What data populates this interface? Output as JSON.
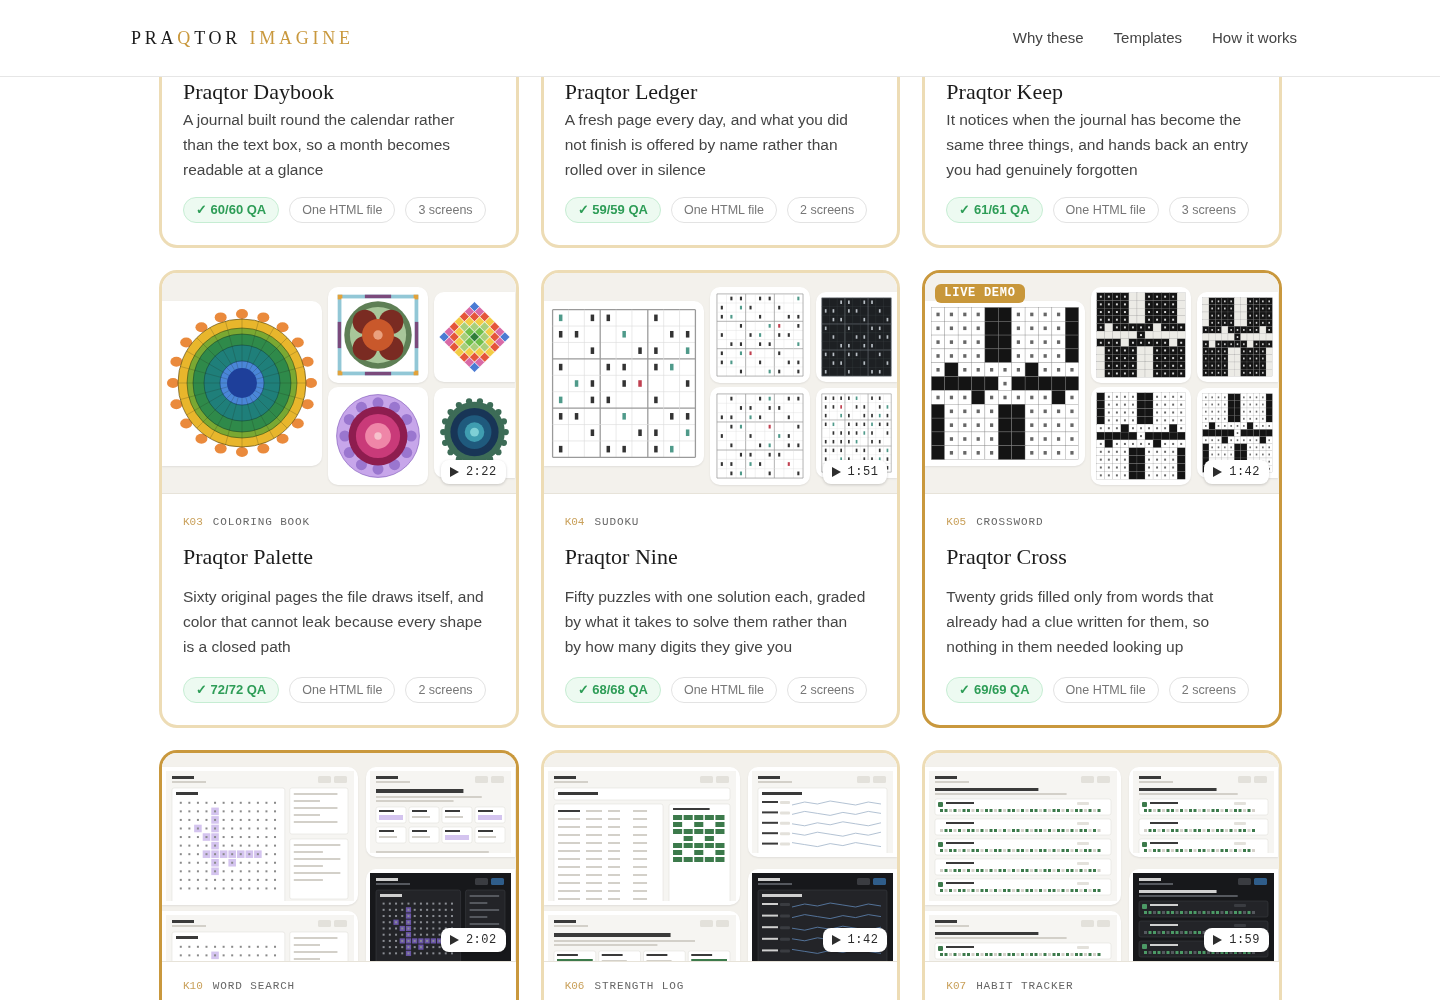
{
  "header": {
    "logo": [
      {
        "parts": [
          {
            "text": "PRA",
            "accent": false
          },
          {
            "text": "Q",
            "accent": true
          },
          {
            "text": "TOR",
            "accent": false
          }
        ]
      },
      {
        "parts": [
          {
            "text": "IMAGINE",
            "accent": true
          }
        ]
      }
    ],
    "nav": [
      "Why these",
      "Templates",
      "How it works"
    ]
  },
  "rows": [
    {
      "cards": [
        {
          "highlighted": false,
          "title": "Praqtor Daybook",
          "description": "A journal built round the calendar rather than the text box, so a month becomes readable at a glance",
          "tags": [
            {
              "kind": "qa",
              "text": "✓ 60/60 QA"
            },
            {
              "kind": "info",
              "text": "One HTML file"
            },
            {
              "kind": "info",
              "text": "3 screens"
            }
          ]
        },
        {
          "highlighted": false,
          "title": "Praqtor Ledger",
          "description": "A fresh page every day, and what you did not finish is offered by name rather than rolled over in silence",
          "tags": [
            {
              "kind": "qa",
              "text": "✓ 59/59 QA"
            },
            {
              "kind": "info",
              "text": "One HTML file"
            },
            {
              "kind": "info",
              "text": "2 screens"
            }
          ]
        },
        {
          "highlighted": false,
          "title": "Praqtor Keep",
          "description": "It notices when the journal has become the same three things, and hands back an entry you had genuinely forgotten",
          "tags": [
            {
              "kind": "qa",
              "text": "✓ 61/61 QA"
            },
            {
              "kind": "info",
              "text": "One HTML file"
            },
            {
              "kind": "info",
              "text": "3 screens"
            }
          ]
        }
      ]
    },
    {
      "cards": [
        {
          "highlighted": false,
          "preview": {
            "kind": "mandala",
            "duration": "2:22"
          },
          "code": "K03",
          "category": "COLORING BOOK",
          "title": "Praqtor Palette",
          "description": "Sixty original pages the file draws itself, and color that cannot leak because every shape is a closed path",
          "tags": [
            {
              "kind": "qa",
              "text": "✓ 72/72 QA"
            },
            {
              "kind": "info",
              "text": "One HTML file"
            },
            {
              "kind": "info",
              "text": "2 screens"
            }
          ]
        },
        {
          "highlighted": false,
          "preview": {
            "kind": "sudoku",
            "duration": "1:51"
          },
          "code": "K04",
          "category": "SUDOKU",
          "title": "Praqtor Nine",
          "description": "Fifty puzzles with one solution each, graded by what it takes to solve them rather than by how many digits they give you",
          "tags": [
            {
              "kind": "qa",
              "text": "✓ 68/68 QA"
            },
            {
              "kind": "info",
              "text": "One HTML file"
            },
            {
              "kind": "info",
              "text": "2 screens"
            }
          ]
        },
        {
          "highlighted": true,
          "badge": "LIVE DEMO",
          "preview": {
            "kind": "crossword",
            "duration": "1:42"
          },
          "code": "K05",
          "category": "CROSSWORD",
          "title": "Praqtor Cross",
          "description": "Twenty grids filled only from words that already had a clue written for them, so nothing in them needed looking up",
          "tags": [
            {
              "kind": "qa",
              "text": "✓ 69/69 QA"
            },
            {
              "kind": "info",
              "text": "One HTML file"
            },
            {
              "kind": "info",
              "text": "2 screens"
            }
          ]
        }
      ]
    },
    {
      "cards": [
        {
          "highlighted": true,
          "preview": {
            "kind": "wordsearch",
            "duration": "2:02"
          },
          "code": "K10",
          "category": "WORD SEARCH"
        },
        {
          "highlighted": false,
          "preview": {
            "kind": "strength",
            "duration": "1:42"
          },
          "code": "K06",
          "category": "STRENGTH LOG"
        },
        {
          "highlighted": false,
          "preview": {
            "kind": "habit",
            "duration": "1:59"
          },
          "code": "K07",
          "category": "HABIT TRACKER"
        }
      ]
    }
  ]
}
